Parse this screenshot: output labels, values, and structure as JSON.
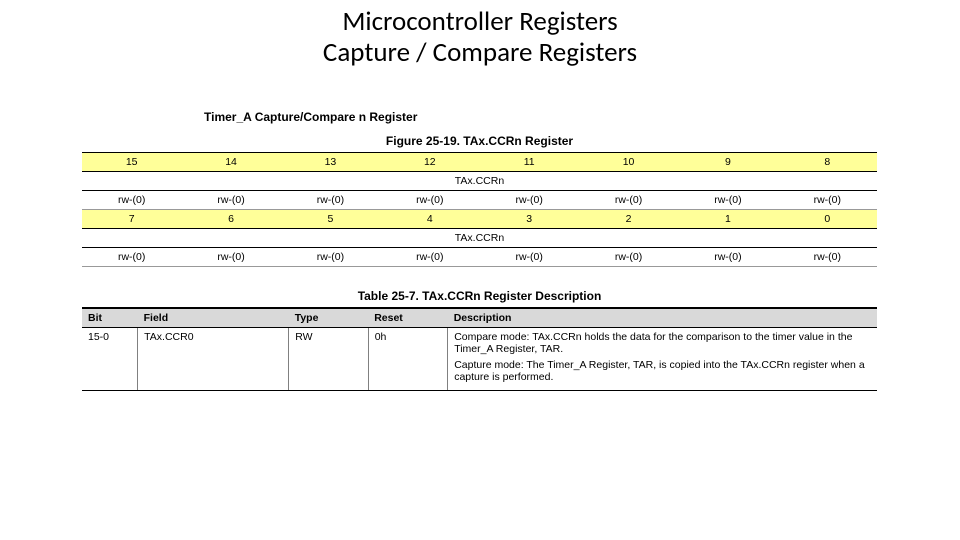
{
  "title": {
    "line1": "Microcontroller Registers",
    "line2": "Capture / Compare Registers"
  },
  "section_heading": "Timer_A Capture/Compare n Register",
  "figure_caption": "Figure 25-19. TAx.CCRn Register",
  "bit_diagram": {
    "rows": [
      {
        "numbers": [
          "15",
          "14",
          "13",
          "12",
          "11",
          "10",
          "9",
          "8"
        ],
        "label": "TAx.CCRn",
        "access": [
          "rw-(0)",
          "rw-(0)",
          "rw-(0)",
          "rw-(0)",
          "rw-(0)",
          "rw-(0)",
          "rw-(0)",
          "rw-(0)"
        ]
      },
      {
        "numbers": [
          "7",
          "6",
          "5",
          "4",
          "3",
          "2",
          "1",
          "0"
        ],
        "label": "TAx.CCRn",
        "access": [
          "rw-(0)",
          "rw-(0)",
          "rw-(0)",
          "rw-(0)",
          "rw-(0)",
          "rw-(0)",
          "rw-(0)",
          "rw-(0)"
        ]
      }
    ]
  },
  "table_caption": "Table 25-7. TAx.CCRn Register Description",
  "desc_table": {
    "headers": {
      "bit": "Bit",
      "field": "Field",
      "type": "Type",
      "reset": "Reset",
      "description": "Description"
    },
    "row": {
      "bit": "15-0",
      "field": "TAx.CCR0",
      "type": "RW",
      "reset": "0h",
      "desc1": "Compare mode: TAx.CCRn holds the data for the comparison to the timer value in the Timer_A Register, TAR.",
      "desc2": "Capture mode: The Timer_A Register, TAR, is copied into the TAx.CCRn register when a capture is performed."
    }
  }
}
